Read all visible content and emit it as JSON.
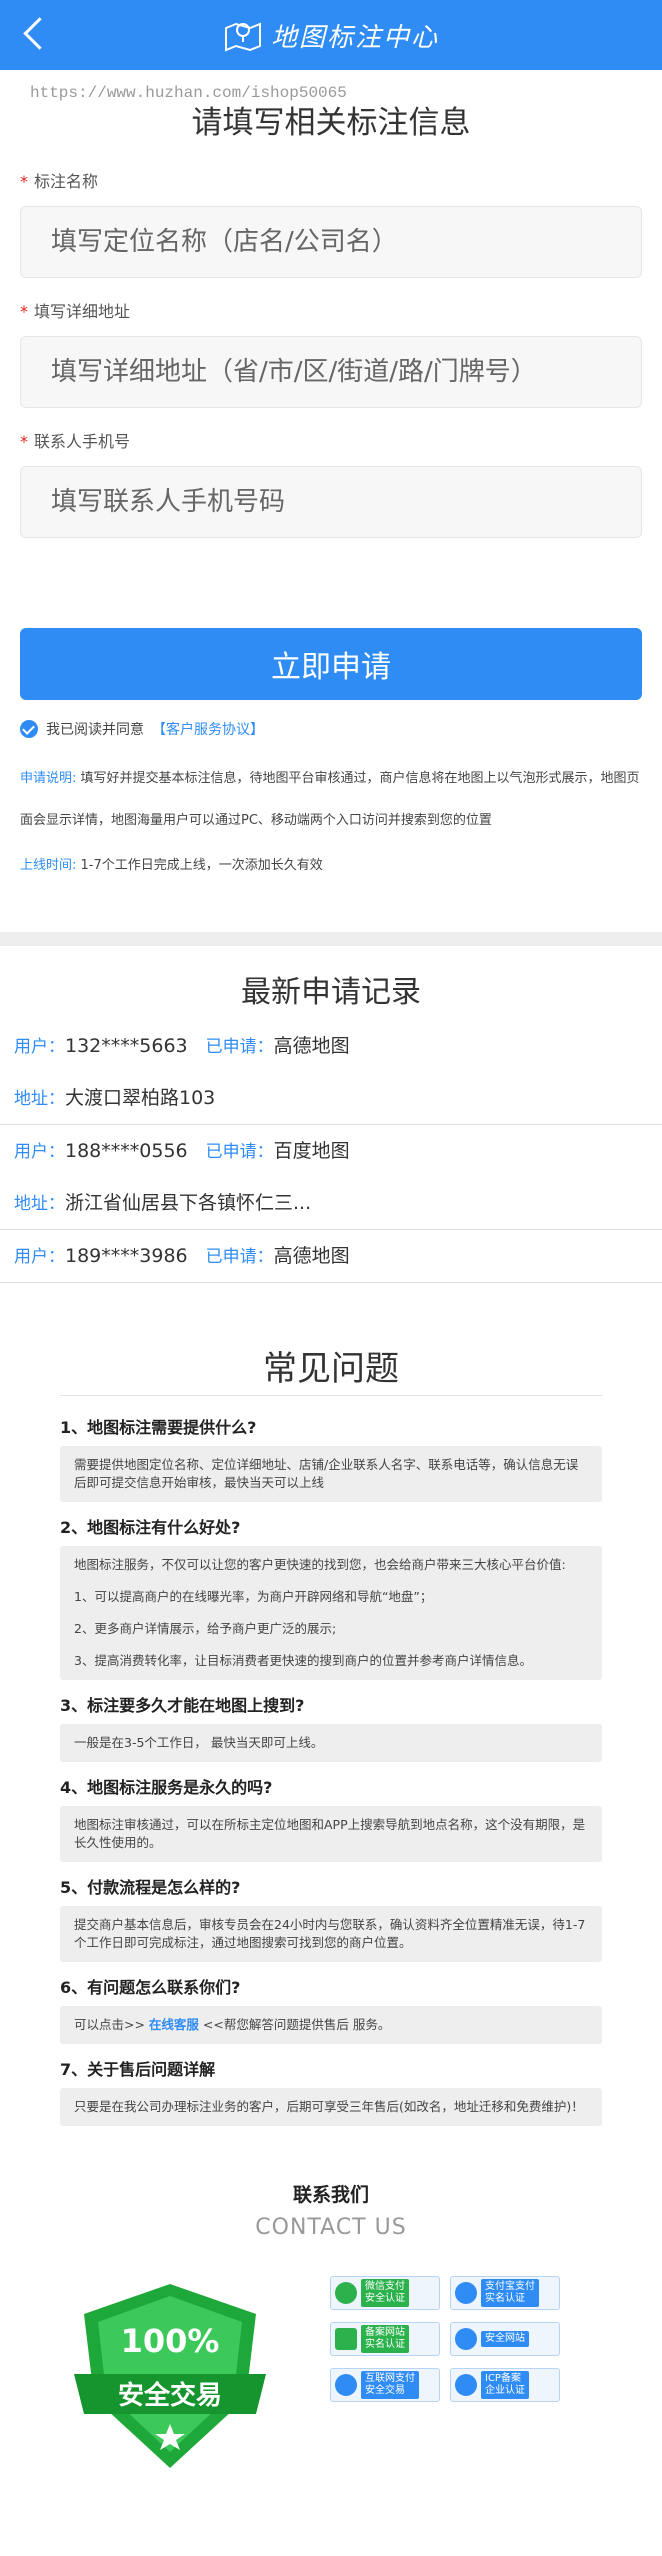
{
  "header": {
    "title": "地图标注中心"
  },
  "watermark": "https://www.huzhan.com/ishop50065",
  "form": {
    "title": "请填写相关标注信息",
    "fields": [
      {
        "label": "标注名称",
        "placeholder": "填写定位名称（店名/公司名）"
      },
      {
        "label": "填写详细地址",
        "placeholder": "填写详细地址（省/市/区/街道/路/门牌号）"
      },
      {
        "label": "联系人手机号",
        "placeholder": "填写联系人手机号码"
      }
    ],
    "required_mark": "*",
    "submit_label": "立即申请",
    "agree_text": "我已阅读并同意",
    "agree_link": "【客户服务协议】",
    "note_label": "申请说明:",
    "note_text": "填写好并提交基本标注信息，待地图平台审核通过，商户信息将在地图上以气泡形式展示，地图页面会显示详情，地图海量用户可以通过PC、移动端两个入口访问并搜索到您的位置",
    "online_label": "上线时间:",
    "online_text": "1-7个工作日完成上线，一次添加长久有效"
  },
  "records": {
    "title": "最新申请记录",
    "user_label": "用户：",
    "applied_label": "已申请：",
    "address_label": "地址：",
    "items": [
      {
        "user": "132****5663",
        "map": "高德地图",
        "address": "大渡口翠柏路103"
      },
      {
        "user": "188****0556",
        "map": "百度地图",
        "address": "浙江省仙居县下各镇怀仁三..."
      },
      {
        "user": "189****3986",
        "map": "高德地图",
        "address": ""
      }
    ]
  },
  "faq": {
    "title": "常见问题",
    "items": [
      {
        "q": "1、地图标注需要提供什么?",
        "a": [
          "需要提供地图定位名称、定位详细地址、店铺/企业联系人名字、联系电话等，确认信息无误后即可提交信息开始审核，最快当天可以上线"
        ]
      },
      {
        "q": "2、地图标注有什么好处?",
        "a": [
          "地图标注服务，不仅可以让您的客户更快速的找到您，也会给商户带来三大核心平台价值:",
          "1、可以提高商户的在线曝光率，为商户开辟网络和导航“地盘”；",
          "2、更多商户详情展示，给予商户更广泛的展示;",
          "3、提高消费转化率，让目标消费者更快速的搜到商户的位置并参考商户详情信息。"
        ]
      },
      {
        "q": "3、标注要多久才能在地图上搜到?",
        "a": [
          "一般是在3-5个工作日， 最快当天即可上线。"
        ]
      },
      {
        "q": "4、地图标注服务是永久的吗?",
        "a": [
          "地图标注审核通过，可以在所标主定位地图和APP上搜索导航到地点名称，这个没有期限，是长久性使用的。"
        ]
      },
      {
        "q": "5、付款流程是怎么样的?",
        "a": [
          "提交商户基本信息后，审核专员会在24小时内与您联系，确认资料齐全位置精准无误，待1-7个工作日即可完成标注，通过地图搜索可找到您的商户位置。"
        ]
      },
      {
        "q": "6、有问题怎么联系你们?",
        "a_prefix": "可以点击>> ",
        "a_link": "在线客服",
        "a_suffix": " <<帮您解答问题提供售后 服务。"
      },
      {
        "q": "7、关于售后问题详解",
        "a": [
          "只要是在我公司办理标注业务的客户，后期可享受三年售后(如改名，地址迁移和免费维护)！"
        ]
      }
    ]
  },
  "contact": {
    "title": "联系我们",
    "subtitle": "CONTACT US",
    "shield_percent": "100%",
    "shield_text": "安全交易",
    "certs": [
      {
        "top": "微信支付",
        "bottom": "安全认证",
        "color": "#2bb24c"
      },
      {
        "top": "支付宝支付",
        "bottom": "实名认证",
        "color": "#2f8cf5"
      },
      {
        "top": "备案网站",
        "bottom": "实名认证",
        "color": "#2bb24c"
      },
      {
        "top": "",
        "bottom": "安全网站",
        "color": "#2f8cf5"
      },
      {
        "top": "互联网支付",
        "bottom": "安全交易",
        "color": "#2f8cf5"
      },
      {
        "top": "ICP备案",
        "bottom": "企业认证",
        "color": "#2f8cf5"
      }
    ]
  }
}
